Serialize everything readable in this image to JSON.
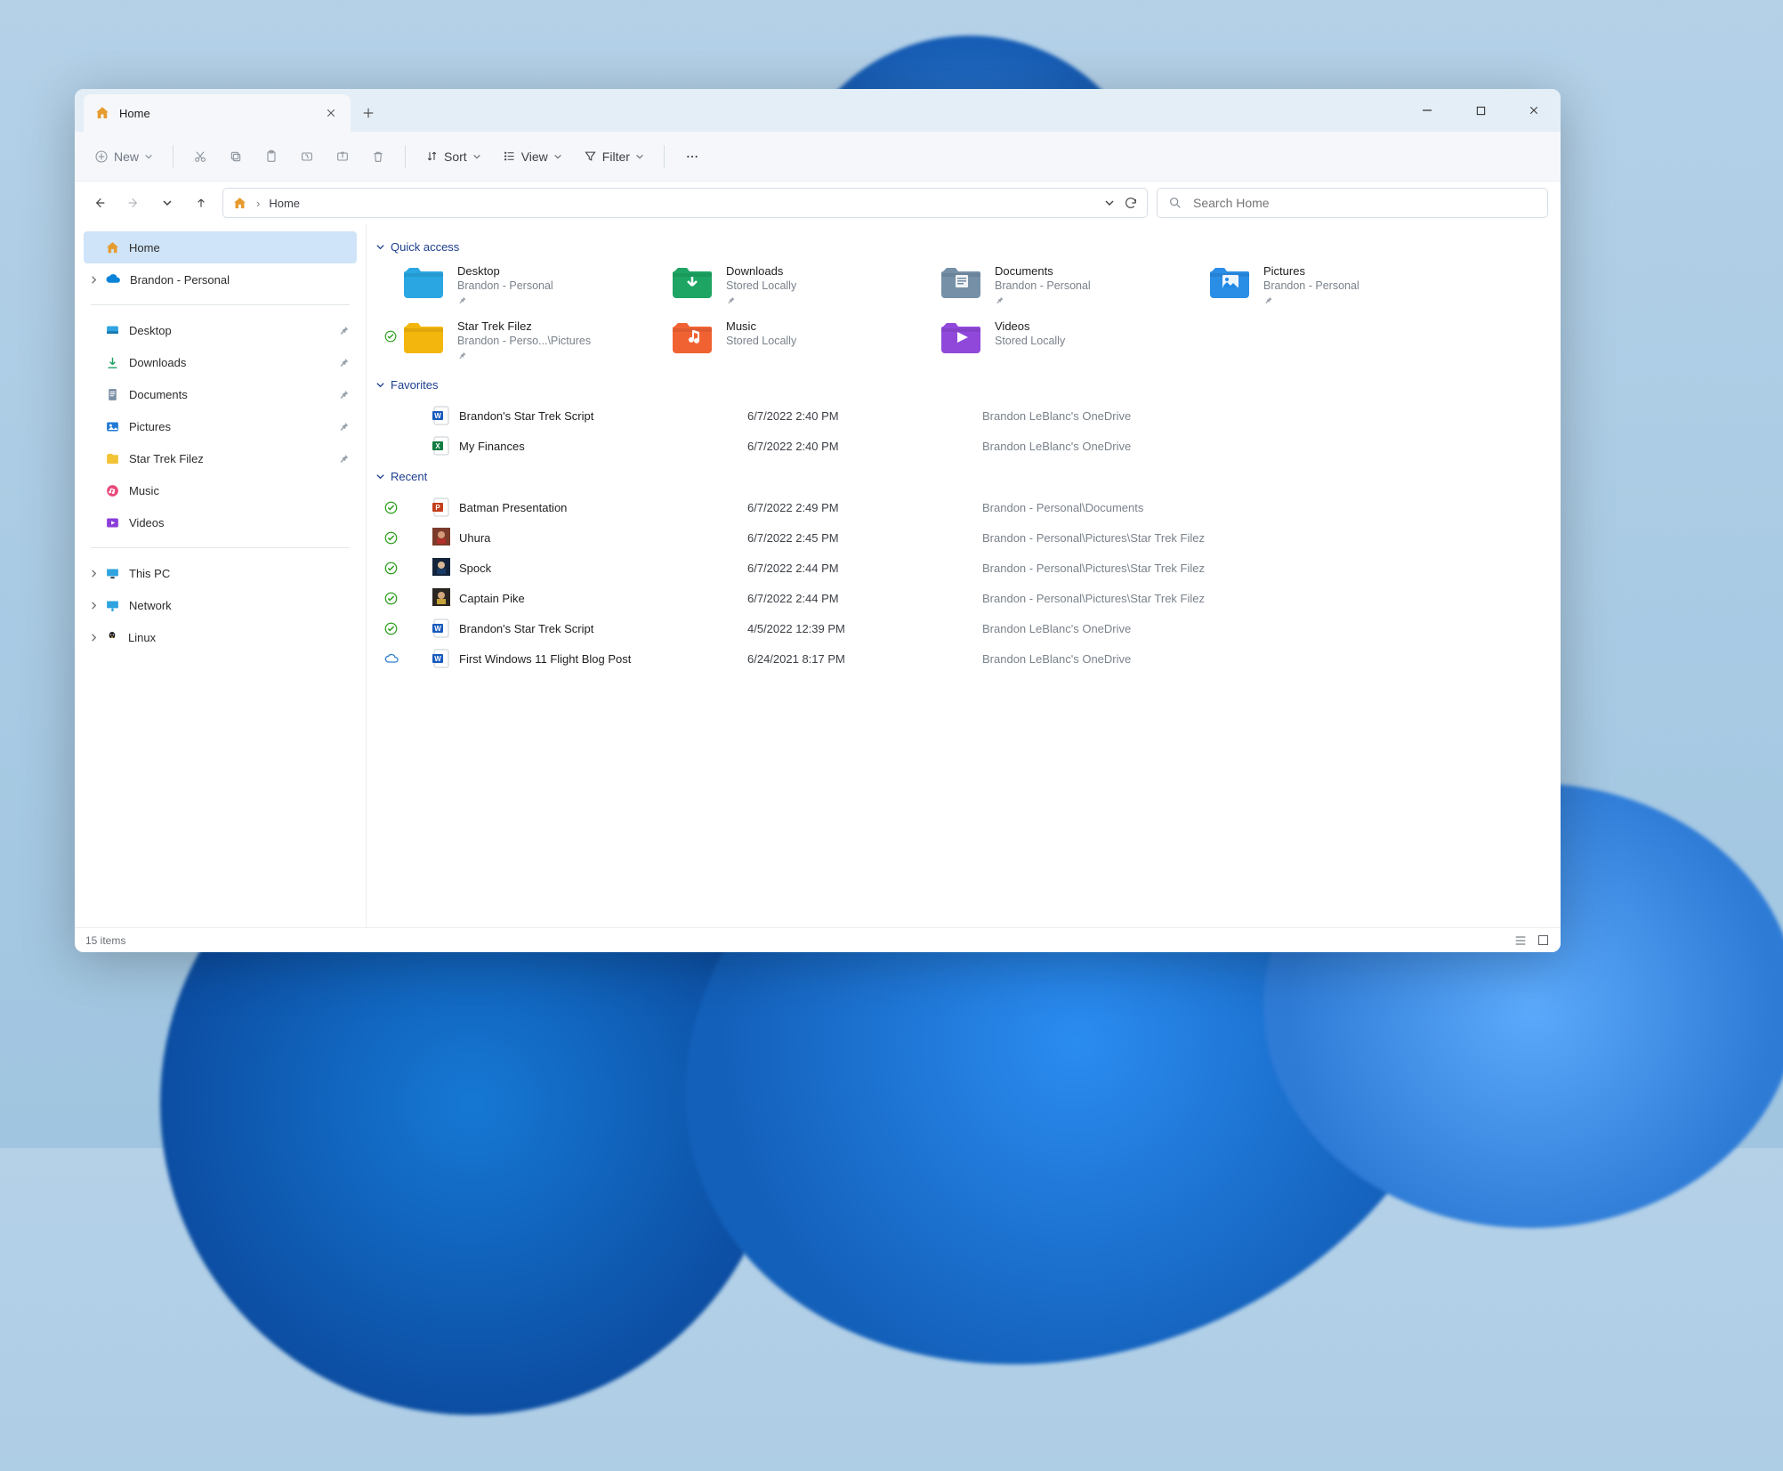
{
  "tab": {
    "title": "Home"
  },
  "toolbar": {
    "new_label": "New",
    "sort_label": "Sort",
    "view_label": "View",
    "filter_label": "Filter"
  },
  "address": {
    "crumb": "Home"
  },
  "search": {
    "placeholder": "Search Home"
  },
  "sidebar": {
    "home": "Home",
    "onedrive": "Brandon - Personal",
    "pinned": [
      "Desktop",
      "Downloads",
      "Documents",
      "Pictures",
      "Star Trek Filez",
      "Music",
      "Videos"
    ],
    "system": [
      "This PC",
      "Network",
      "Linux"
    ]
  },
  "sections": {
    "quick_access": "Quick access",
    "favorites": "Favorites",
    "recent": "Recent"
  },
  "quick_access": [
    {
      "name": "Desktop",
      "sub": "Brandon - Personal",
      "pin": true,
      "color": "#1fa2e0",
      "glyph": ""
    },
    {
      "name": "Downloads",
      "sub": "Stored Locally",
      "pin": true,
      "color": "#12a05c",
      "glyph": "down"
    },
    {
      "name": "Documents",
      "sub": "Brandon - Personal",
      "pin": true,
      "color": "#6f8aa2",
      "glyph": "doc"
    },
    {
      "name": "Pictures",
      "sub": "Brandon - Personal",
      "pin": true,
      "color": "#1f88e5",
      "glyph": "pic"
    },
    {
      "name": "Star Trek Filez",
      "sub": "Brandon - Perso...\\Pictures",
      "pin": true,
      "color": "#f2b200",
      "glyph": "",
      "sync": true
    },
    {
      "name": "Music",
      "sub": "Stored Locally",
      "pin": false,
      "color": "#f05a28",
      "glyph": "note"
    },
    {
      "name": "Videos",
      "sub": "Stored Locally",
      "pin": false,
      "color": "#8a3ed9",
      "glyph": "play"
    }
  ],
  "favorites": [
    {
      "icon": "word",
      "name": "Brandon's Star Trek Script",
      "date": "6/7/2022 2:40 PM",
      "loc": "Brandon LeBlanc's OneDrive"
    },
    {
      "icon": "excel",
      "name": "My Finances",
      "date": "6/7/2022 2:40 PM",
      "loc": "Brandon LeBlanc's OneDrive"
    }
  ],
  "recent": [
    {
      "sync": "ok",
      "icon": "ppt",
      "name": "Batman Presentation",
      "date": "6/7/2022 2:49 PM",
      "loc": "Brandon - Personal\\Documents"
    },
    {
      "sync": "ok",
      "icon": "img1",
      "name": "Uhura",
      "date": "6/7/2022 2:45 PM",
      "loc": "Brandon - Personal\\Pictures\\Star Trek Filez"
    },
    {
      "sync": "ok",
      "icon": "img2",
      "name": "Spock",
      "date": "6/7/2022 2:44 PM",
      "loc": "Brandon - Personal\\Pictures\\Star Trek Filez"
    },
    {
      "sync": "ok",
      "icon": "img3",
      "name": "Captain Pike",
      "date": "6/7/2022 2:44 PM",
      "loc": "Brandon - Personal\\Pictures\\Star Trek Filez"
    },
    {
      "sync": "ok",
      "icon": "word",
      "name": "Brandon's Star Trek Script",
      "date": "4/5/2022 12:39 PM",
      "loc": "Brandon LeBlanc's OneDrive"
    },
    {
      "sync": "cloud",
      "icon": "word",
      "name": "First Windows 11 Flight Blog Post",
      "date": "6/24/2021 8:17 PM",
      "loc": "Brandon LeBlanc's OneDrive"
    }
  ],
  "status": {
    "count": "15 items"
  }
}
